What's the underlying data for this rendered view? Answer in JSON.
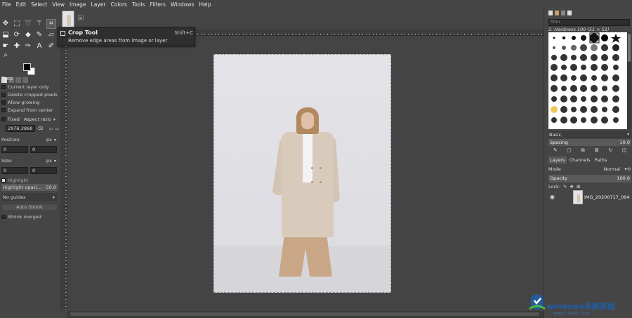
{
  "menubar": {
    "items": [
      "File",
      "Edit",
      "Select",
      "View",
      "Image",
      "Layer",
      "Colors",
      "Tools",
      "Filters",
      "Windows",
      "Help"
    ]
  },
  "toolbox": {
    "tool_icons": [
      "move-icon",
      "rect-select-icon",
      "lasso-icon",
      "fuzzy-select-icon",
      "crop-icon",
      "unified-transform-icon",
      "warp-icon",
      "cage-icon",
      "bucket-fill-icon",
      "paintbrush-icon",
      "eraser-icon",
      "smudge-icon",
      "dodge-icon",
      "heal-icon",
      "path-icon",
      "text-icon",
      "color-picker-icon",
      "zoom-icon"
    ],
    "active_tool": "crop-icon",
    "foreground_color": "#000000",
    "background_color": "#ffffff"
  },
  "tool_options": {
    "title": "Crop",
    "current_layer_only": "Current layer only",
    "delete_cropped": "Delete cropped pixels",
    "allow_growing": "Allow growing",
    "expand_from_center": "Expand from center",
    "fixed_label": "Fixed",
    "fixed_value": "Aspect ratio",
    "ratio_value": "2976:3968",
    "position_label": "Position:",
    "position_unit": "px",
    "position_x": "0",
    "position_y": "0",
    "size_label": "Size:",
    "size_unit": "px",
    "size_w": "0",
    "size_h": "0",
    "highlight_label": "Highlight",
    "highlight_opacity_label": "Highlight opaci...",
    "highlight_opacity_value": "50.0",
    "guides_value": "No guides",
    "auto_shrink": "Auto Shrink",
    "shrink_merged": "Shrink merged"
  },
  "tooltip": {
    "title": "Crop Tool",
    "shortcut": "Shift+C",
    "description": "Remove edge areas from image or layer"
  },
  "brushes": {
    "filter_placeholder": "filter",
    "brush_name": "2. Hardness 100 (51 × 51)",
    "preset": "Basic,",
    "spacing_label": "Spacing",
    "spacing_value": "10.0"
  },
  "layers": {
    "tabs": [
      "Layers",
      "Channels",
      "Paths"
    ],
    "mode_label": "Mode",
    "mode_value": "Normal",
    "opacity_label": "Opacity",
    "opacity_value": "100.0",
    "lock_label": "Lock:",
    "layer_name": "IMG_20200717_094"
  },
  "watermark": {
    "title": "windows系统家园",
    "url": "www.ruihafu.com"
  }
}
